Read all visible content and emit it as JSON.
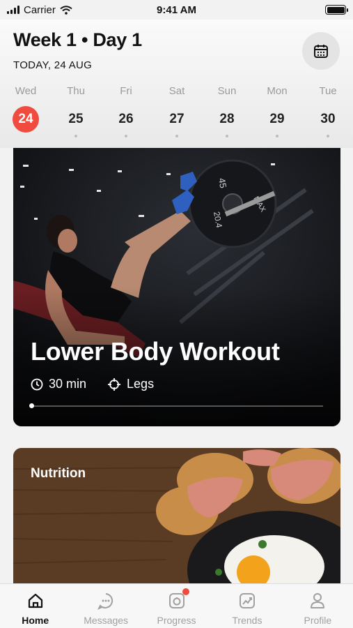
{
  "status_bar": {
    "carrier": "Carrier",
    "time": "9:41 AM"
  },
  "header": {
    "title": "Week 1 • Day 1",
    "subtitle": "TODAY, 24 AUG",
    "calendar_icon": "calendar-icon"
  },
  "days": [
    {
      "name": "Wed",
      "num": "24",
      "active": true
    },
    {
      "name": "Thu",
      "num": "25"
    },
    {
      "name": "Fri",
      "num": "26"
    },
    {
      "name": "Sat",
      "num": "27"
    },
    {
      "name": "Sun",
      "num": "28"
    },
    {
      "name": "Mon",
      "num": "29"
    },
    {
      "name": "Tue",
      "num": "30"
    }
  ],
  "workout": {
    "title": "Lower Body Workout",
    "duration": "30 min",
    "target": "Legs",
    "progress": 0.0,
    "plate_labels": [
      "45",
      "20.4",
      "MAX"
    ]
  },
  "nutrition": {
    "title": "Nutrition"
  },
  "tabs": [
    {
      "label": "Home",
      "icon": "home-icon",
      "active": true
    },
    {
      "label": "Messages",
      "icon": "chat-icon"
    },
    {
      "label": "Progress",
      "icon": "progress-icon",
      "badge": true
    },
    {
      "label": "Trends",
      "icon": "trends-icon"
    },
    {
      "label": "Profile",
      "icon": "profile-icon"
    }
  ],
  "colors": {
    "accent": "#ef4b3f"
  }
}
